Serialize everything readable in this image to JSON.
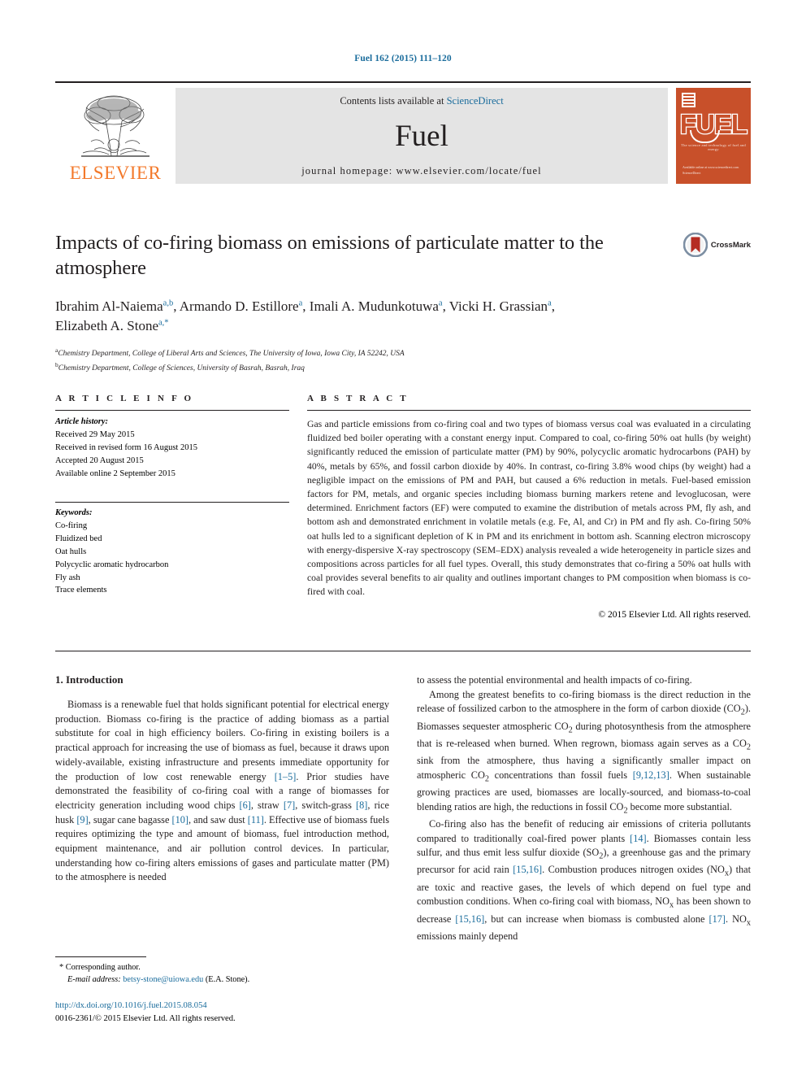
{
  "running_head": "Fuel 162 (2015) 111–120",
  "masthead": {
    "contents_prefix": "Contents lists available at ",
    "sciencedirect": "ScienceDirect",
    "journal_name": "Fuel",
    "homepage": "journal homepage: www.elsevier.com/locate/fuel",
    "elsevier_wordmark": "ELSEVIER",
    "cover": {
      "title": "FUEL",
      "subtitle": "The science and technology of fuel and energy",
      "bottom_note": "Available online at www.sciencedirect.com\nScienceDirect"
    },
    "colors": {
      "link_blue": "#1a6c9c",
      "elsevier_orange": "#f3792b",
      "cover_orange": "#c8502a",
      "band_gray": "#e4e4e4"
    }
  },
  "article": {
    "title": "Impacts of co-firing biomass on emissions of particulate matter to the atmosphere",
    "crossmark_label": "CrossMark",
    "authors": [
      {
        "name": "Ibrahim Al-Naiema",
        "marks": "a,b",
        "sep": ", "
      },
      {
        "name": "Armando D. Estillore",
        "marks": "a",
        "sep": ", "
      },
      {
        "name": "Imali A. Mudunkotuwa",
        "marks": "a",
        "sep": ", "
      },
      {
        "name": "Vicki H. Grassian",
        "marks": "a",
        "sep": ", "
      },
      {
        "name": "Elizabeth A. Stone",
        "marks": "a,*",
        "sep": ""
      }
    ],
    "affiliations": [
      {
        "mark": "a",
        "text": "Chemistry Department, College of Liberal Arts and Sciences, The University of Iowa, Iowa City, IA 52242, USA"
      },
      {
        "mark": "b",
        "text": "Chemistry Department, College of Sciences, University of Basrah, Basrah, Iraq"
      }
    ]
  },
  "article_info": {
    "heading": "A R T I C L E  I N F O",
    "history_title": "Article history:",
    "history": [
      "Received 29 May 2015",
      "Received in revised form 16 August 2015",
      "Accepted 20 August 2015",
      "Available online 2 September 2015"
    ],
    "keywords_title": "Keywords:",
    "keywords": [
      "Co-firing",
      "Fluidized bed",
      "Oat hulls",
      "Polycyclic aromatic hydrocarbon",
      "Fly ash",
      "Trace elements"
    ]
  },
  "abstract": {
    "heading": "A B S T R A C T",
    "text": "Gas and particle emissions from co-firing coal and two types of biomass versus coal was evaluated in a circulating fluidized bed boiler operating with a constant energy input. Compared to coal, co-firing 50% oat hulls (by weight) significantly reduced the emission of particulate matter (PM) by 90%, polycyclic aromatic hydrocarbons (PAH) by 40%, metals by 65%, and fossil carbon dioxide by 40%. In contrast, co-firing 3.8% wood chips (by weight) had a negligible impact on the emissions of PM and PAH, but caused a 6% reduction in metals. Fuel-based emission factors for PM, metals, and organic species including biomass burning markers retene and levoglucosan, were determined. Enrichment factors (EF) were computed to examine the distribution of metals across PM, fly ash, and bottom ash and demonstrated enrichment in volatile metals (e.g. Fe, Al, and Cr) in PM and fly ash. Co-firing 50% oat hulls led to a significant depletion of K in PM and its enrichment in bottom ash. Scanning electron microscopy with energy-dispersive X-ray spectroscopy (SEM–EDX) analysis revealed a wide heterogeneity in particle sizes and compositions across particles for all fuel types. Overall, this study demonstrates that co-firing a 50% oat hulls with coal provides several benefits to air quality and outlines important changes to PM composition when biomass is co-fired with coal.",
    "copyright": "© 2015 Elsevier Ltd. All rights reserved."
  },
  "body": {
    "section_title": "1. Introduction",
    "left_paragraph_1_a": "Biomass is a renewable fuel that holds significant potential for electrical energy production. Biomass co-firing is the practice of adding biomass as a partial substitute for coal in high efficiency boilers. Co-firing in existing boilers is a practical approach for increasing the use of biomass as fuel, because it draws upon widely-available, existing infrastructure and presents immediate opportunity for the production of low cost renewable energy ",
    "ref_1_5": "[1–5]",
    "left_paragraph_1_b": ". Prior studies have demonstrated the feasibility of co-firing coal with a range of biomasses for electricity generation including wood chips ",
    "ref_6": "[6]",
    "left_b2": ", straw ",
    "ref_7": "[7]",
    "left_b3": ", switch-grass ",
    "ref_8": "[8]",
    "left_b4": ", rice husk ",
    "ref_9": "[9]",
    "left_b5": ", sugar cane bagasse ",
    "ref_10": "[10]",
    "left_b6": ", and saw dust ",
    "ref_11": "[11]",
    "left_b7": ". Effective use of biomass fuels requires optimizing the type and amount of biomass, fuel introduction method, equipment maintenance, and air pollution control devices. In particular, understanding how co-firing alters emissions of gases and particulate matter (PM) to the atmosphere is needed",
    "right_p1": "to assess the potential environmental and health impacts of co-firing.",
    "right_p2_a": "Among the greatest benefits to co-firing biomass is the direct reduction in the release of fossilized carbon to the atmosphere in the form of carbon dioxide (CO",
    "right_p2_b": "). Biomasses sequester atmospheric CO",
    "right_p2_c": " during photosynthesis from the atmosphere that is re-released when burned. When regrown, biomass again serves as a CO",
    "right_p2_d": " sink from the atmosphere, thus having a significantly smaller impact on atmospheric CO",
    "right_p2_e": " concentrations than fossil fuels ",
    "ref_9_12_13": "[9,12,13]",
    "right_p2_f": ". When sustainable growing practices are used, biomasses are locally-sourced, and biomass-to-coal blending ratios are high, the reductions in fossil CO",
    "right_p2_g": " become more substantial.",
    "right_p3_a": "Co-firing also has the benefit of reducing air emissions of criteria pollutants compared to traditionally coal-fired power plants ",
    "ref_14": "[14]",
    "right_p3_b": ". Biomasses contain less sulfur, and thus emit less sulfur dioxide (SO",
    "right_p3_c": "), a greenhouse gas and the primary precursor for acid rain ",
    "ref_15_16": "[15,16]",
    "right_p3_d": ". Combustion produces nitrogen oxides (NO",
    "right_p3_e": ") that are toxic and reactive gases, the levels of which depend on fuel type and combustion conditions. When co-firing coal with biomass, NO",
    "right_p3_f": " has been shown to decrease ",
    "ref_15_16b": "[15,16]",
    "right_p3_g": ", but can increase when biomass is combusted alone ",
    "ref_17": "[17]",
    "right_p3_h": ". NO",
    "right_p3_i": " emissions mainly depend",
    "sub_2": "2",
    "sub_x": "x"
  },
  "footnote": {
    "corresponding_mark": "*",
    "corresponding_text": "Corresponding author.",
    "email_label": "E-mail address:",
    "email": "betsy-stone@uiowa.edu",
    "email_owner": "(E.A. Stone)."
  },
  "footer": {
    "doi": "http://dx.doi.org/10.1016/j.fuel.2015.08.054",
    "issn_line": "0016-2361/© 2015 Elsevier Ltd. All rights reserved."
  }
}
